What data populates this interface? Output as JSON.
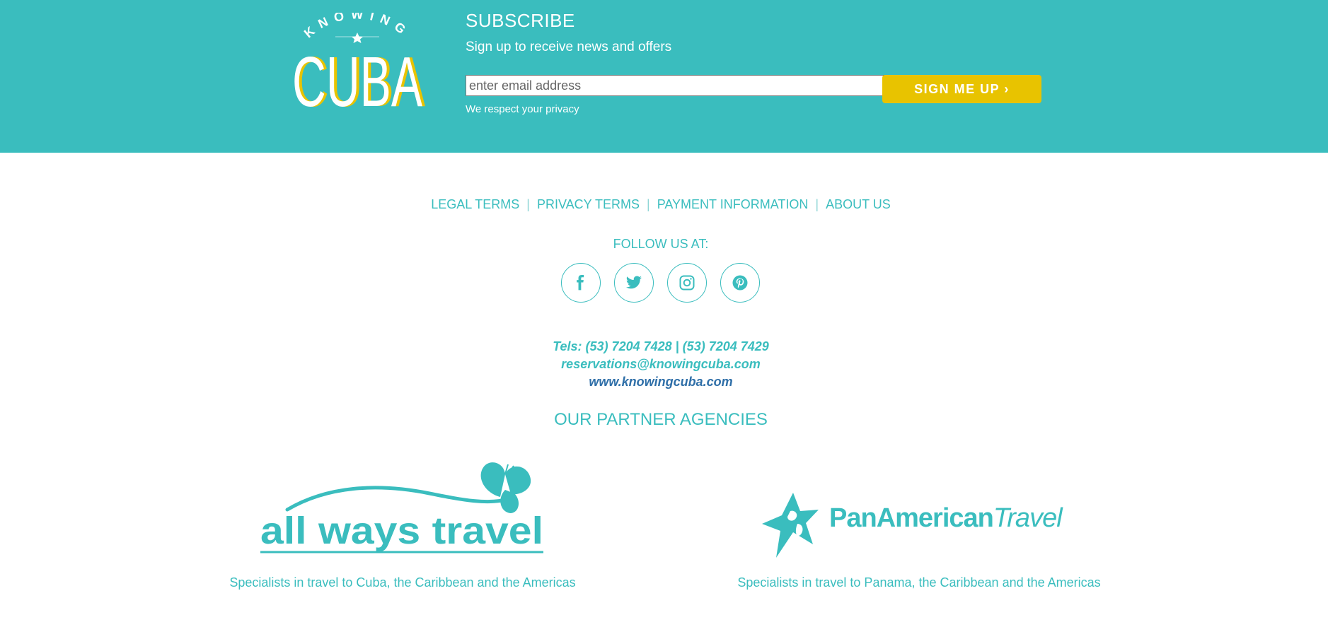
{
  "brand": {
    "logo_top": "KNOWING",
    "logo_main": "CUBA",
    "teal": "#3abdbe",
    "yellow": "#e8c300"
  },
  "subscribe": {
    "title": "SUBSCRIBE",
    "text": "Sign up to receive news and offers",
    "email_placeholder": "enter email address",
    "email_value": "",
    "button_label": "SIGN ME UP ›",
    "privacy_note": "We respect your privacy"
  },
  "footer_links": [
    {
      "label": "LEGAL TERMS"
    },
    {
      "label": "PRIVACY TERMS"
    },
    {
      "label": "PAYMENT INFORMATION"
    },
    {
      "label": "ABOUT US"
    }
  ],
  "follow": {
    "label": "FOLLOW US AT:",
    "icons": [
      "facebook-icon",
      "twitter-icon",
      "instagram-icon",
      "pinterest-icon"
    ]
  },
  "contact": {
    "phones": "Tels: (53) 7204 7428 | (53) 7204 7429",
    "email": "reservations@knowingcuba.com",
    "website": "www.knowingcuba.com"
  },
  "partners": {
    "title": "OUR PARTNER AGENCIES",
    "items": [
      {
        "logo_text": "all ways travel",
        "description": "Specialists in travel to Cuba, the Caribbean and the Americas"
      },
      {
        "logo_text_a": "PanAmerican",
        "logo_text_b": "Travel",
        "description": "Specialists in travel to Panama, the Caribbean and the Americas"
      }
    ]
  }
}
